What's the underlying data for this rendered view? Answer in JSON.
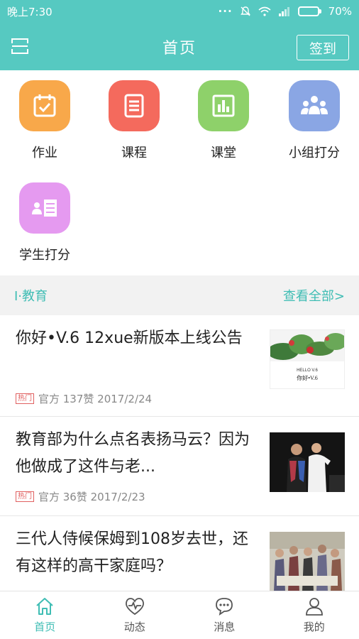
{
  "status_bar": {
    "time": "晚上7:30",
    "battery": "70%",
    "battery_level": 0.7
  },
  "header": {
    "title": "首页",
    "checkin_label": "签到",
    "menu_icon": "menu-icon"
  },
  "grid": [
    {
      "label": "作业",
      "icon": "calendar-check-icon",
      "color": "#f8a84a"
    },
    {
      "label": "课程",
      "icon": "list-doc-icon",
      "color": "#f46a5d"
    },
    {
      "label": "课堂",
      "icon": "bar-chart-icon",
      "color": "#8ed16a"
    },
    {
      "label": "小组打分",
      "icon": "group-icon",
      "color": "#8aa6e4"
    },
    {
      "label": "学生打分",
      "icon": "student-card-icon",
      "color": "#e59af0"
    }
  ],
  "section": {
    "name": "I·教育",
    "more_label": "查看全部>"
  },
  "news": [
    {
      "title": "你好•V.6 12xue新版本上线公告",
      "tag": "热门",
      "meta": "官方 137赞 2017/2/24"
    },
    {
      "title": "教育部为什么点名表扬马云？因为他做成了这件与老...",
      "tag": "热门",
      "meta": "官方 36赞 2017/2/23"
    },
    {
      "title": "三代人侍候保姆到108岁去世，还有这样的高干家庭吗？",
      "tag": "",
      "meta": ""
    }
  ],
  "thumb1": {
    "line1": "HELLO   V.6",
    "line2": "你好•V.6"
  },
  "bottom_nav": [
    {
      "label": "首页",
      "icon": "home-icon",
      "active": true
    },
    {
      "label": "动态",
      "icon": "heart-pulse-icon",
      "active": false
    },
    {
      "label": "消息",
      "icon": "chat-bubble-icon",
      "active": false
    },
    {
      "label": "我的",
      "icon": "person-icon",
      "active": false
    }
  ],
  "colors": {
    "accent": "#56c9c1",
    "accent_text": "#3fbdb4",
    "hot_tag": "#e06060"
  }
}
